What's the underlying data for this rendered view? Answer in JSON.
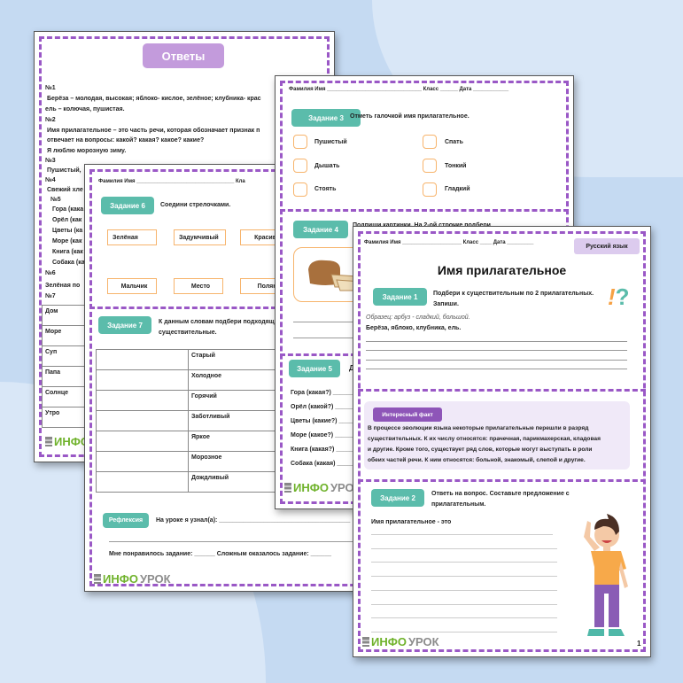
{
  "answers_page": {
    "title": "Ответы",
    "lines": [
      "№1",
      "Берёза – молодая, высокая; яблоко- кислое, зелёное; клубника- крас",
      "ель – колючая, пушистая.",
      "№2",
      "Имя прилагательное – это часть речи, которая обозначает признак п",
      "отвечает на вопросы: какой? какая? какое? какие?",
      "Я люблю морозную зиму.",
      "№3",
      "Пушистый,",
      "№4",
      "Свежий хле",
      "№5",
      "Гора (кака",
      "Орёл (как",
      "Цветы (ка",
      "Море (как",
      "Книга (как",
      "Собака (ка",
      "№6",
      "Зелёная по",
      "№7"
    ],
    "table_rows": [
      "Дом",
      "Море",
      "Суп",
      "Папа",
      "Солнце",
      "Утро"
    ]
  },
  "logo": {
    "part1": "ИНФО",
    "part2": "УРОК"
  },
  "page_b": {
    "header": "Фамилия Имя _________________________________ Кла",
    "task6": {
      "label": "Задание 6",
      "text": "Соедини стрелочками.",
      "top_words": [
        "Зелёная",
        "Задумчивый",
        "Красивая"
      ],
      "bottom_words": [
        "Мальчик",
        "Место",
        "Поляна"
      ]
    },
    "task7": {
      "label": "Задание 7",
      "text1": "К данным словам подбери подходящие",
      "text2": "существительные.",
      "words": [
        "Старый",
        "Холодное",
        "Горячий",
        "Заботливый",
        "Яркое",
        "Морозное",
        "Дождливый"
      ]
    },
    "reflection": {
      "label": "Рефлексия",
      "learned": "На уроке я узнал(а): ______________________________________",
      "liked": "Мне понравилось задание: ______ Сложным оказалось задание: ______"
    }
  },
  "page_c": {
    "header": "Фамилия Имя ________________________________ Класс ______ Дата ____________",
    "task3": {
      "label": "Задание 3",
      "text": "Отметь галочкой имя прилагательное.",
      "options_left": [
        "Пушистый",
        "Дышать",
        "Стоять"
      ],
      "options_right": [
        "Спать",
        "Тонкий",
        "Гладкий"
      ]
    },
    "task4": {
      "label": "Задание 4",
      "text": "Подпиши картинки. На 2-ой строчке подбери"
    },
    "task5": {
      "label": "Задание 5",
      "text": "Д",
      "items": [
        "Гора (какая?) ________",
        "Орёл (какой?) ________",
        "Цветы (какие?) ________",
        "Море (какое?) ________",
        "Книга (какая?) ________",
        "Собака (какая) ________"
      ]
    }
  },
  "page_d": {
    "header": "Фамилия Имя ____________________ Класс ____ Дата _________",
    "subject": "Русский язык",
    "title": "Имя прилагательное",
    "task1": {
      "label": "Задание 1",
      "text1": "Подбери к существительным по 2 прилагательных.",
      "text2": "Запиши.",
      "example": "Образец: арбуз - сладкий, большой.",
      "words": "Берёза, яблоко, клубника, ель."
    },
    "fact": {
      "label": "Интересный факт",
      "lines": [
        "В процессе эволюции языка некоторые прилагательные перешли в разряд",
        "существительных. К их числу относятся: прачечная, парикмахерская, кладовая",
        "и другие. Кроме того, существует ряд слов, которые могут выступать в роли",
        "обеих частей речи. К ним относятся: больной, знакомый, слепой и другие."
      ]
    },
    "task2": {
      "label": "Задание 2",
      "text1": "Ответь на вопрос. Составьте предложение с",
      "text2": "прилагательным.",
      "prompt": "Имя прилагательное  -  это"
    },
    "page_number": "1"
  },
  "colors": {
    "frame": "#9a58c6",
    "task_button": "#5bbcab",
    "checkbox": "#f7b46c",
    "logo_green": "#6fb22b",
    "answers_badge": "#c39bdc"
  }
}
